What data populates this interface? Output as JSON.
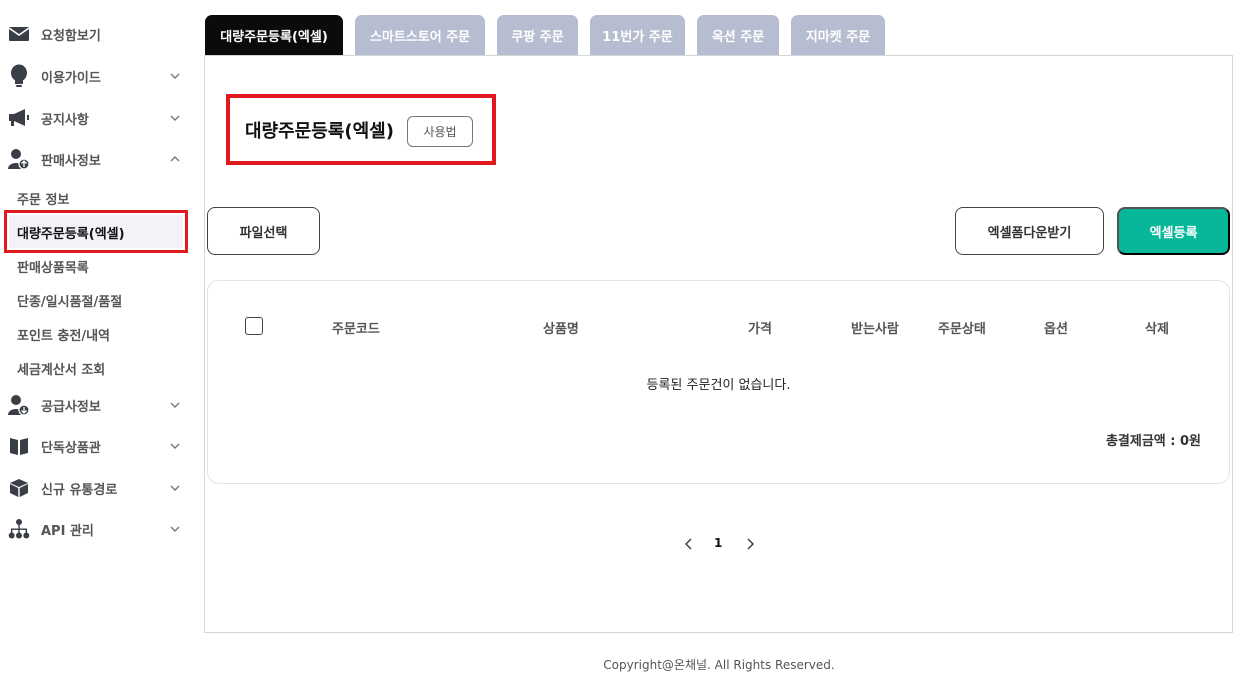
{
  "sidebar": {
    "items": [
      {
        "label": "요청함보기",
        "icon": "envelope-icon"
      },
      {
        "label": "이용가이드",
        "icon": "lightbulb-icon"
      },
      {
        "label": "공지사항",
        "icon": "megaphone-icon"
      },
      {
        "label": "판매사정보",
        "icon": "seller-user-icon"
      },
      {
        "label": "공급사정보",
        "icon": "supplier-user-icon"
      },
      {
        "label": "단독상품관",
        "icon": "book-icon"
      },
      {
        "label": "신규 유통경로",
        "icon": "box-icon"
      },
      {
        "label": "API 관리",
        "icon": "network-icon"
      }
    ],
    "sub_items": [
      {
        "label": "주문 정보"
      },
      {
        "label": "대량주문등록(엑셀)"
      },
      {
        "label": "판매상품목록"
      },
      {
        "label": "단종/일시품절/품절"
      },
      {
        "label": "포인트 충전/내역"
      },
      {
        "label": "세금계산서 조회"
      }
    ]
  },
  "tabs": [
    {
      "label": "대량주문등록(엑셀)"
    },
    {
      "label": "스마트스토어 주문"
    },
    {
      "label": "쿠팡 주문"
    },
    {
      "label": "11번가 주문"
    },
    {
      "label": "옥션 주문"
    },
    {
      "label": "지마켓 주문"
    }
  ],
  "main": {
    "title": "대량주문등록(엑셀)",
    "usage_label": "사용법",
    "file_select_label": "파일선택",
    "excel_form_download_label": "엑셀폼다운받기",
    "excel_register_label": "엑셀등록",
    "table": {
      "headers": [
        "주문코드",
        "상품명",
        "가격",
        "받는사람",
        "주문상태",
        "옵션",
        "삭제"
      ],
      "empty_message": "등록된 주문건이 없습니다.",
      "total_label": "총결제금액 : 0원"
    },
    "pagination": {
      "current_page": "1"
    }
  },
  "footer": {
    "copyright": "Copyright@온채널. All Rights Reserved."
  },
  "colors": {
    "primary": "#07b79a",
    "tab_active": "#0b0b0b",
    "tab_inactive": "#b7bdd0",
    "highlight": "#e0191f"
  }
}
